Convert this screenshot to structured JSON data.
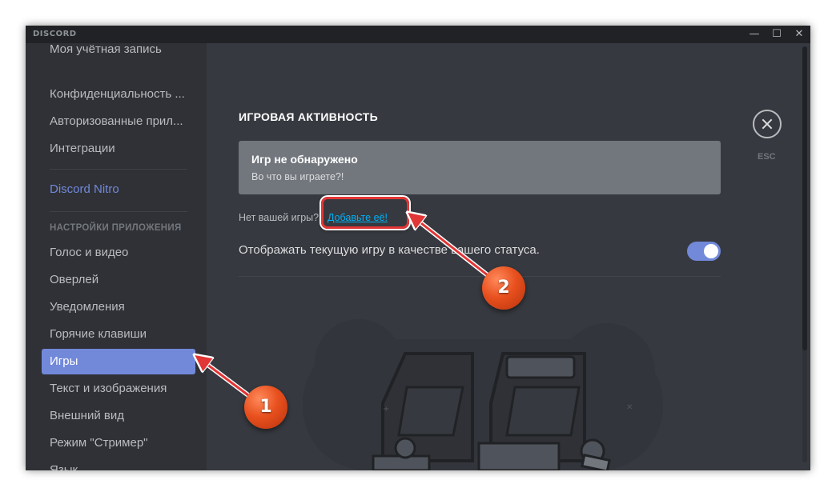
{
  "app": {
    "brand": "DISCORD",
    "window_controls": {
      "minimize": "—",
      "maximize": "☐",
      "close": "✕"
    }
  },
  "sidebar": {
    "partial_item": "Моя учётная запись",
    "items_top": [
      {
        "label": "Конфиденциальность ..."
      },
      {
        "label": "Авторизованные прил..."
      },
      {
        "label": "Интеграции"
      }
    ],
    "nitro": "Discord Nitro",
    "app_settings_header": "НАСТРОЙКИ ПРИЛОЖЕНИЯ",
    "items_app": [
      {
        "label": "Голос и видео"
      },
      {
        "label": "Оверлей"
      },
      {
        "label": "Уведомления"
      },
      {
        "label": "Горячие клавиши"
      },
      {
        "label": "Игры",
        "active": true
      },
      {
        "label": "Текст и изображения"
      },
      {
        "label": "Внешний вид"
      },
      {
        "label": "Режим \"Стример\""
      },
      {
        "label": "Язык"
      }
    ]
  },
  "main": {
    "title": "ИГРОВАЯ АКТИВНОСТЬ",
    "game_card": {
      "title": "Игр не обнаружено",
      "subtitle": "Во что вы играете?!"
    },
    "missing_prefix": "Нет вашей игры?",
    "add_link": "Добавьте её!",
    "status_toggle": {
      "label": "Отображать текущую игру в качестве вашего статуса.",
      "enabled": true
    },
    "esc_label": "ESC"
  },
  "annotations": {
    "marker_1": "1",
    "marker_2": "2"
  },
  "colors": {
    "accent": "#7289da",
    "link": "#00b0f4",
    "highlight": "#e23535",
    "marker": "#e8501e"
  }
}
